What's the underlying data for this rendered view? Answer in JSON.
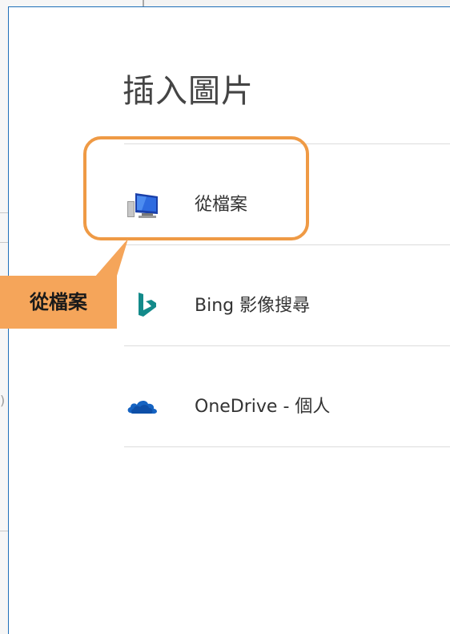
{
  "dialog": {
    "title": "插入圖片",
    "options": [
      {
        "label": "從檔案",
        "icon": "computer-icon"
      },
      {
        "label": "Bing 影像搜尋",
        "icon": "bing-icon"
      },
      {
        "label": "OneDrive - 個人",
        "icon": "onedrive-icon"
      }
    ]
  },
  "callout": {
    "text": "從檔案"
  },
  "colors": {
    "accent": "#ef9a45",
    "callout_fill": "#f5a55a",
    "bing": "#138a8a",
    "onedrive": "#1563c2",
    "dialog_border": "#1e6fb8"
  }
}
